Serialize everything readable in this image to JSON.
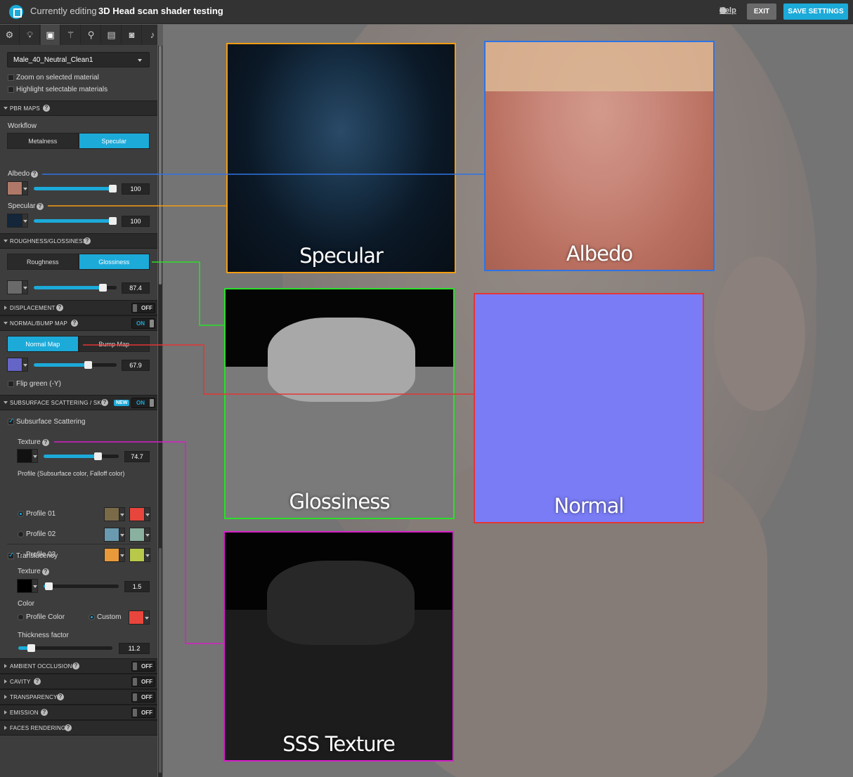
{
  "topbar": {
    "editing_label": "Currently editing",
    "model_name": "3D Head scan shader testing",
    "help_label": "Help",
    "exit_label": "EXIT",
    "save_label": "SAVE SETTINGS"
  },
  "tabs": [
    "gear-icon",
    "lightbulb-icon",
    "image-icon",
    "wand-icon",
    "pin-icon",
    "film-icon",
    "vr-icon",
    "sound-icon"
  ],
  "material": {
    "selected": "Male_40_Neutral_Clean1",
    "zoom_label": "Zoom on selected material",
    "highlight_label": "Highlight selectable materials"
  },
  "pbr": {
    "title": "PBR MAPS",
    "workflow_label": "Workflow",
    "workflow_options": [
      "Metalness",
      "Specular"
    ],
    "workflow_active": "Specular",
    "albedo_label": "Albedo",
    "albedo_value": "100",
    "specular_label": "Specular",
    "specular_value": "100"
  },
  "roughness": {
    "title": "ROUGHNESS/GLOSSINESS",
    "options": [
      "Roughness",
      "Glossiness"
    ],
    "active": "Glossiness",
    "value": "87.4"
  },
  "displacement": {
    "title": "DISPLACEMENT",
    "state": "OFF"
  },
  "normal": {
    "title": "NORMAL/BUMP MAP",
    "state": "ON",
    "options": [
      "Normal Map",
      "Bump Map"
    ],
    "active": "Normal Map",
    "value": "67.9",
    "flip_label": "Flip green (-Y)"
  },
  "sss": {
    "title": "SUBSURFACE SCATTERING / SKIN",
    "badge": "NEW",
    "state": "ON",
    "enabled_label": "Subsurface Scattering",
    "texture_label": "Texture",
    "texture_value": "74.7",
    "profile_label": "Profile (Subsurface color, Falloff color)",
    "profiles": [
      {
        "name": "Profile 01",
        "c1": "#7a6a48",
        "c2": "#e8453c",
        "selected": true
      },
      {
        "name": "Profile 02",
        "c1": "#6a9ab0",
        "c2": "#8ab0a0",
        "selected": false
      },
      {
        "name": "Profile 03",
        "c1": "#e89a3a",
        "c2": "#b8c84a",
        "selected": false
      }
    ],
    "translucency_label": "Translucency",
    "trans_texture_label": "Texture",
    "trans_texture_value": "1.5",
    "color_label": "Color",
    "profile_color_label": "Profile Color",
    "custom_label": "Custom",
    "custom_color": "#e8453c",
    "thickness_label": "Thickness factor",
    "thickness_value": "11.2"
  },
  "sections_bottom": [
    {
      "title": "AMBIENT OCCLUSION",
      "state": "OFF"
    },
    {
      "title": "CAVITY",
      "state": "OFF"
    },
    {
      "title": "TRANSPARENCY",
      "state": "OFF"
    },
    {
      "title": "EMISSION",
      "state": "OFF"
    },
    {
      "title": "FACES RENDERING",
      "state": ""
    }
  ],
  "cards": {
    "specular": "Specular",
    "albedo": "Albedo",
    "glossiness": "Glossiness",
    "normal": "Normal",
    "sss": "SSS Texture"
  },
  "colors": {
    "accent": "#1caad9",
    "specular_line": "#f39c12",
    "albedo_line": "#2f73e6",
    "glossiness_line": "#2bdf2b",
    "normal_line": "#e53535",
    "sss_line": "#d61fc8"
  }
}
